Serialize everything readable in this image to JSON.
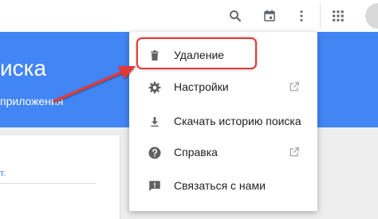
{
  "hero": {
    "title": "иска",
    "subtitle": "приложения"
  },
  "card": {
    "text": "т."
  },
  "menu": {
    "items": [
      {
        "label": "Удаление",
        "icon": "trash-icon",
        "external": false
      },
      {
        "label": "Настройки",
        "icon": "gear-icon",
        "external": true
      },
      {
        "label": "Скачать историю поиска",
        "icon": "download-icon",
        "external": false
      },
      {
        "label": "Справка",
        "icon": "help-icon",
        "external": true
      },
      {
        "label": "Связаться с нами",
        "icon": "feedback-icon",
        "external": false
      }
    ]
  },
  "colors": {
    "accent": "#4285f4",
    "annotation": "#e53935"
  }
}
